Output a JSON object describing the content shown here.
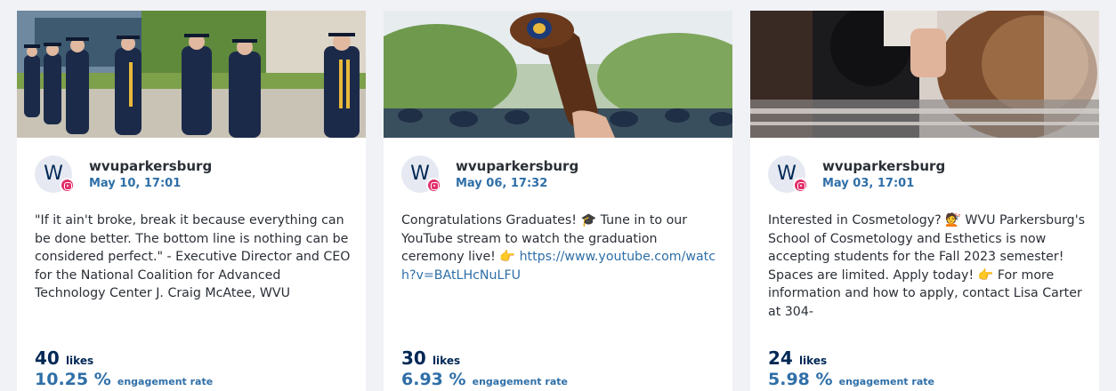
{
  "colors": {
    "page_bg": "#f1f2f6",
    "card_bg": "#ffffff",
    "username": "#2a2f36",
    "accent_blue": "#2f6fa8",
    "navy": "#002855",
    "instagram": "#e1306c"
  },
  "posts": [
    {
      "avatar_letter": "W",
      "network_icon": "instagram-icon",
      "username": "wvuparkersburg",
      "timestamp": "May 10, 17:01",
      "caption": "\"If it ain't broke, break it because everything can be done better. The bottom line is nothing can be considered perfect.\" - Executive Director and CEO for the National Coalition for Advanced Technology Center J. Craig McAtee, WVU",
      "likes": "40",
      "likes_label": "likes",
      "engagement": "10.25 %",
      "engagement_label": "engagement rate"
    },
    {
      "avatar_letter": "W",
      "network_icon": "instagram-icon",
      "username": "wvuparkersburg",
      "timestamp": "May 06, 17:32",
      "caption_part1": "Congratulations Graduates! 🎓 Tune in to our YouTube stream to watch the graduation ceremony live! 👉 ",
      "caption_link": "https://www.youtube.com/watch?v=BAtLHcNuLFU",
      "likes": "30",
      "likes_label": "likes",
      "engagement": "6.93 %",
      "engagement_label": "engagement rate"
    },
    {
      "avatar_letter": "W",
      "network_icon": "instagram-icon",
      "username": "wvuparkersburg",
      "timestamp": "May 03, 17:01",
      "caption": "Interested in Cosmetology? 💇 WVU Parkersburg's School of Cosmetology and Esthetics is now accepting students for the Fall 2023 semester! Spaces are limited. Apply today! 👉 For more information and how to apply, contact Lisa Carter at 304-",
      "likes": "24",
      "likes_label": "likes",
      "engagement": "5.98 %",
      "engagement_label": "engagement rate"
    }
  ]
}
